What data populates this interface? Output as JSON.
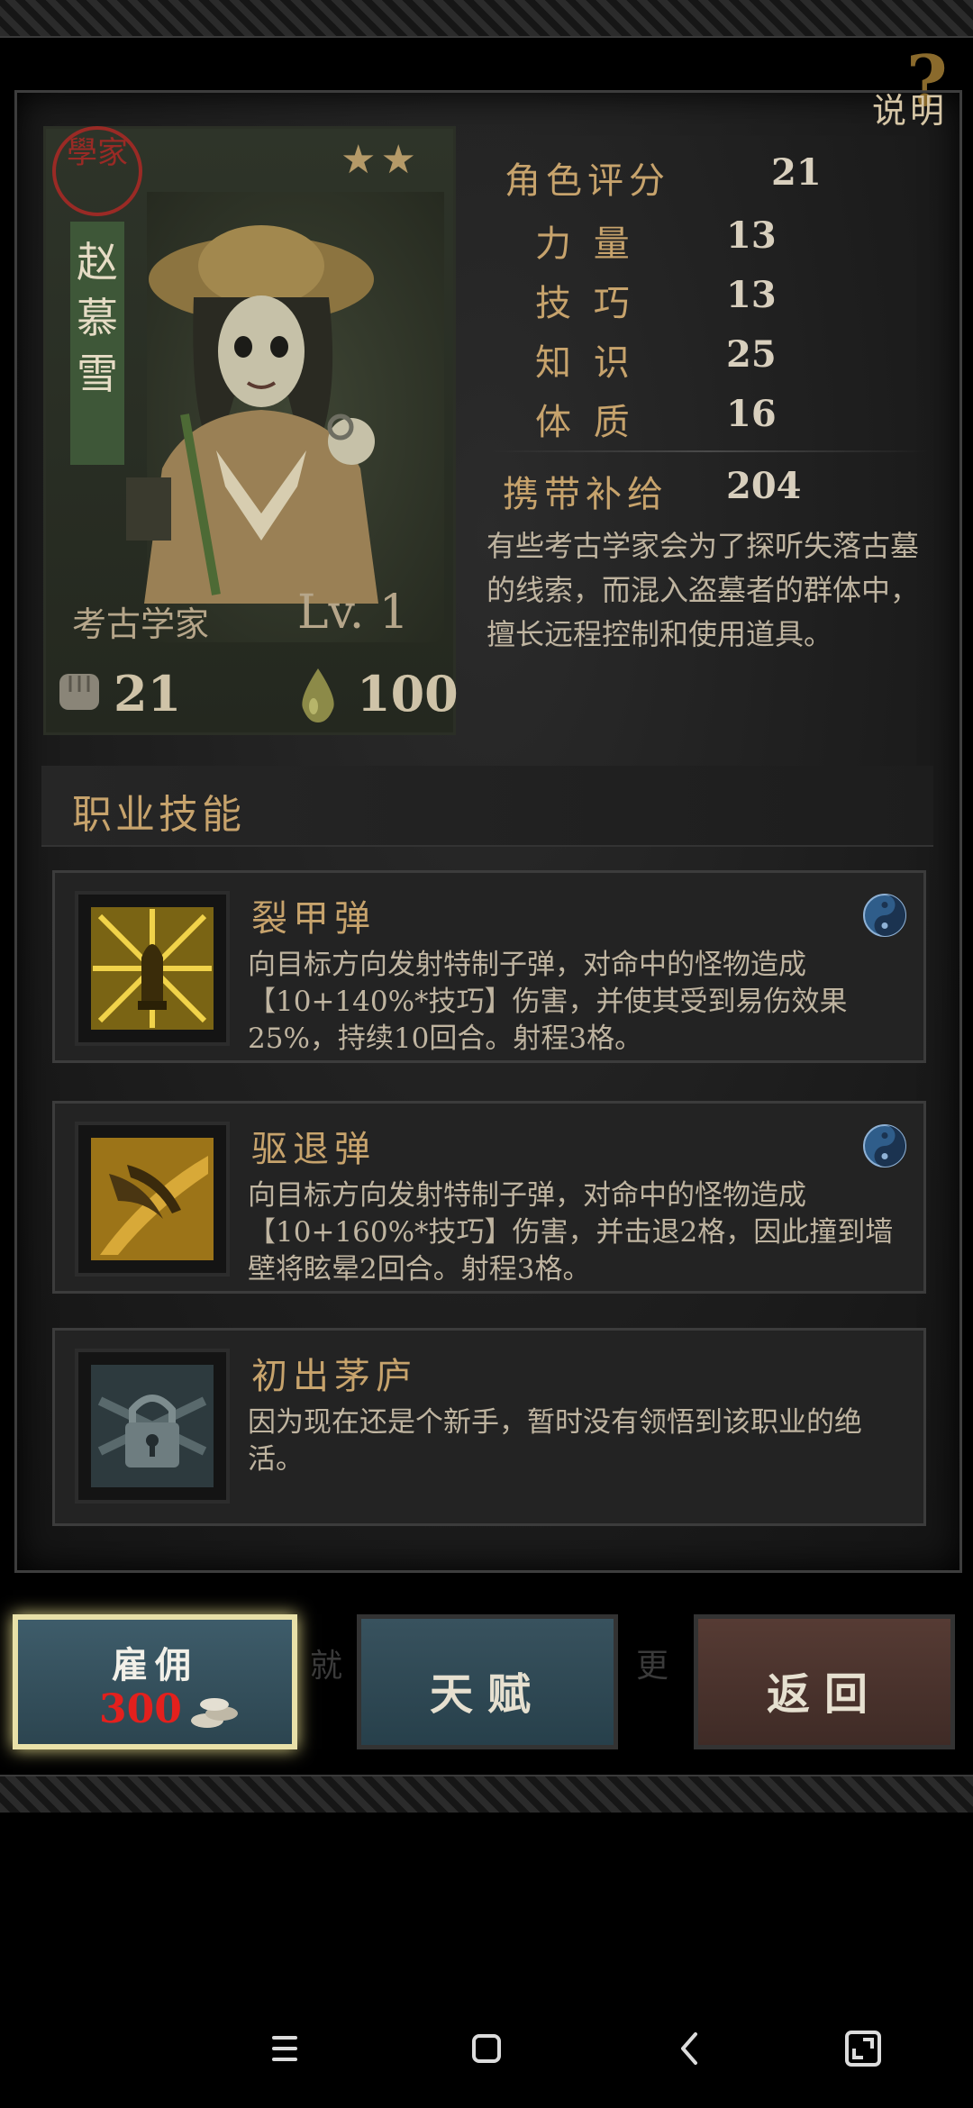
{
  "help": {
    "mark": "?",
    "label": "说明"
  },
  "character": {
    "seal": "學家",
    "name_chars": [
      "赵",
      "慕",
      "雪"
    ],
    "stars": 2,
    "class_name": "考古学家",
    "level": "Lv. 1",
    "power": "21",
    "hp": "100"
  },
  "stats": [
    {
      "label": "角色评分",
      "value": "21"
    },
    {
      "label": "力 量",
      "value": "13"
    },
    {
      "label": "技 巧",
      "value": "13"
    },
    {
      "label": "知 识",
      "value": "25"
    },
    {
      "label": "体 质",
      "value": "16"
    },
    {
      "label": "携带补给",
      "value": "204"
    }
  ],
  "description": "有些考古学家会为了探听失落古墓的线索，而混入盗墓者的群体中，擅长远程控制和使用道具。",
  "skills_header": "职业技能",
  "skills": [
    {
      "title": "裂甲弹",
      "text": "向目标方向发射特制子弹，对命中的怪物造成【10+140%*技巧】伤害，并使其受到易伤效果25%，持续10回合。射程3格。",
      "icon": "bullet-icon",
      "badge": "yin-yang-icon"
    },
    {
      "title": "驱退弹",
      "text": "向目标方向发射特制子弹，对命中的怪物造成【10+160%*技巧】伤害，并击退2格，因此撞到墙壁将眩晕2回合。射程3格。",
      "icon": "repel-claw-icon",
      "badge": "yin-yang-icon"
    },
    {
      "title": "初出茅庐",
      "text": "因为现在还是个新手，暂时没有领悟到该职业的绝活。",
      "icon": "locked-icon"
    }
  ],
  "buttons": {
    "hire_label": "雇佣",
    "hire_cost": "300",
    "talent_label": "天赋",
    "back_label": "返回",
    "ghost_left": "就",
    "ghost_right": "更"
  },
  "colors": {
    "accent": "#c7a36c",
    "hire_glow": "#e9e1a8",
    "cost": "#e3201d"
  }
}
